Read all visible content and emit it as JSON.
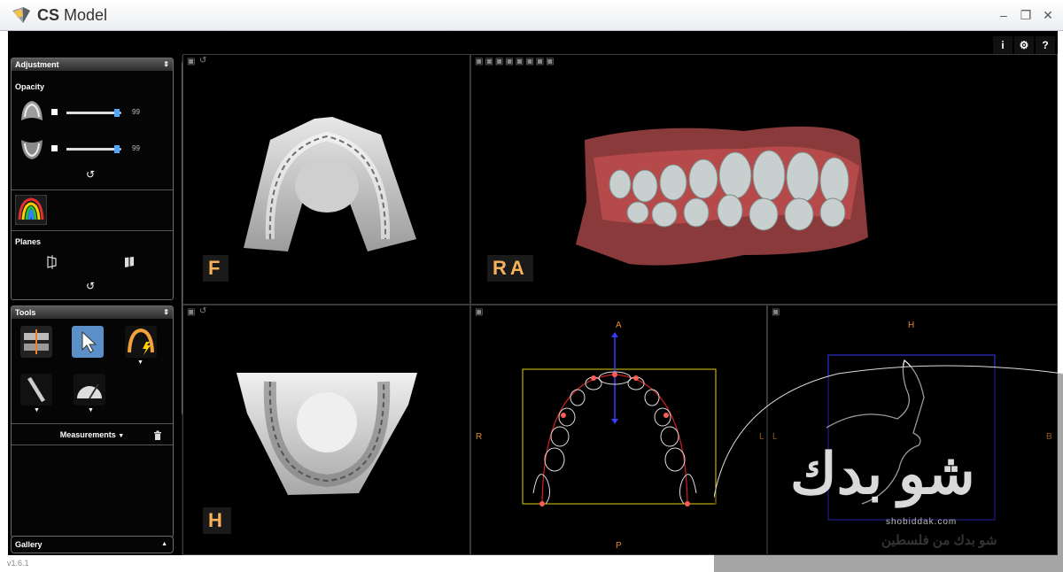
{
  "window": {
    "title_bold": "CS",
    "title_rest": " Model",
    "minimize": "–",
    "maximize": "❐",
    "close": "✕"
  },
  "topbar": {
    "info": "i",
    "settings": "⚙",
    "help": "?"
  },
  "adjustment": {
    "title": "Adjustment",
    "opacity_label": "Opacity",
    "upper_value": "99",
    "lower_value": "99",
    "upper_fraction": 0.9,
    "lower_fraction": 0.9,
    "reset": "↺",
    "planes_label": "Planes",
    "planes_reset": "↺"
  },
  "tools": {
    "title": "Tools",
    "measurements_label": "Measurements",
    "measurements_caret": "▼",
    "trash": "🗑"
  },
  "gallery": {
    "label": "Gallery",
    "caret": "▲"
  },
  "views": {
    "top_left_label": "F",
    "top_right_label": "RA",
    "bottom_left_label": "H",
    "mid_axis": {
      "top": "A",
      "bottom": "P",
      "left": "R",
      "right": "L"
    },
    "right_axis": {
      "top": "H",
      "left": "L",
      "right": "B"
    },
    "view_tool_save": "💾",
    "view_tool_rotate": "↺"
  },
  "version": "v1.6.1",
  "watermark": {
    "main": "شو بدك",
    "latin": "shobiddak.com",
    "sub": "شو بدك من فلسطين"
  },
  "colors": {
    "accent": "#f5b25a",
    "axis": "#e08a2c",
    "arch": "#d02020",
    "box": "#e0d000",
    "blue": "#3a3aff"
  }
}
